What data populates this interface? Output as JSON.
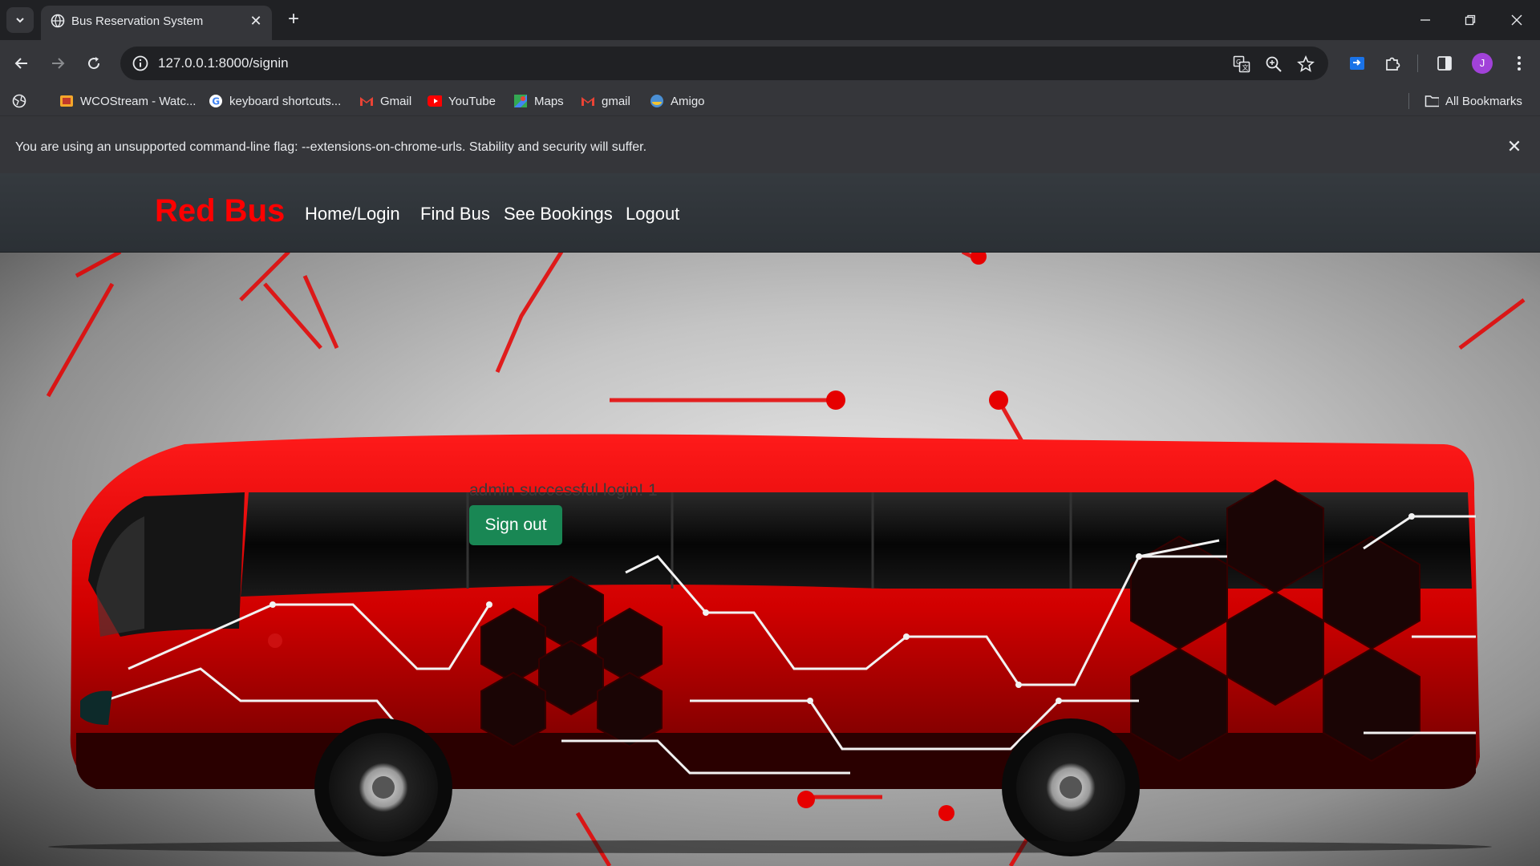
{
  "browser": {
    "tab": {
      "title": "Bus Reservation System"
    },
    "address": {
      "url": "127.0.0.1:8000/signin"
    },
    "avatar_letter": "J",
    "bookmarks": [
      {
        "label": "WCOStream - Watc...",
        "icon": "wcostream-icon"
      },
      {
        "label": "keyboard shortcuts...",
        "icon": "google-icon"
      },
      {
        "label": "Gmail",
        "icon": "gmail-icon"
      },
      {
        "label": "YouTube",
        "icon": "youtube-icon"
      },
      {
        "label": "Maps",
        "icon": "maps-icon"
      },
      {
        "label": "gmail",
        "icon": "gmail-icon"
      },
      {
        "label": "Amigo",
        "icon": "amigo-icon"
      }
    ],
    "all_bookmarks": "All Bookmarks",
    "infobar": {
      "text": "You are using an unsupported command-line flag: --extensions-on-chrome-urls. Stability and security will suffer."
    }
  },
  "site": {
    "brand": "Red Bus",
    "nav": [
      "Home/Login",
      "Find Bus",
      "See Bookings",
      "Logout"
    ],
    "message": "admin successful login! 1",
    "signout_label": "Sign out"
  },
  "colors": {
    "brand": "#ff0000",
    "signout": "#198754",
    "navbar": "#2b3035",
    "chrome_dark": "#202124",
    "chrome_toolbar": "#35363a"
  }
}
